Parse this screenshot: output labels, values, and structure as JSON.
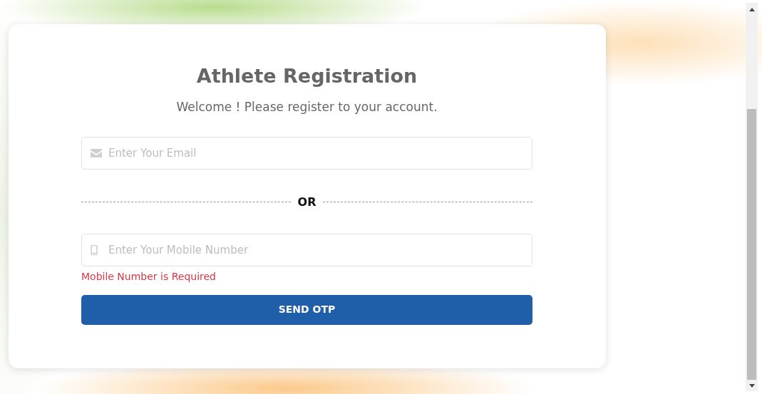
{
  "title": "Athlete Registration",
  "subtitle": "Welcome ! Please register to your account.",
  "email_field": {
    "placeholder": "Enter Your Email"
  },
  "separator": "OR",
  "mobile_field": {
    "placeholder": "Enter Your Mobile Number",
    "error": "Mobile Number is Required"
  },
  "submit_button": "SEND OTP"
}
